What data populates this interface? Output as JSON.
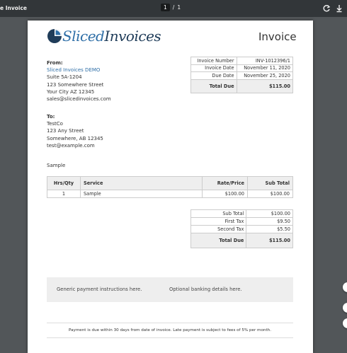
{
  "viewer": {
    "title": "e Invoice",
    "current_page": "1",
    "page_sep": "/",
    "total_pages": "1"
  },
  "logo": {
    "part1": "Sliced",
    "part2": "Invoices"
  },
  "heading": "Invoice",
  "from": {
    "label": "From:",
    "name": "Sliced Invoices DEMO",
    "address1": "Suite 5A-1204",
    "address2": "123 Somewhere Street",
    "address3": "Your City AZ 12345",
    "email": "sales@slicedinvoices.com"
  },
  "meta": [
    {
      "label": "Invoice Number",
      "value": "INV-1012396/1"
    },
    {
      "label": "Invoice Date",
      "value": "November 11, 2020"
    },
    {
      "label": "Due Date",
      "value": "November 25, 2020"
    }
  ],
  "meta_total": {
    "label": "Total Due",
    "value": "$115.00"
  },
  "to": {
    "label": "To:",
    "name": "TestCo",
    "address1": "123 Any Street",
    "address2": "Somewhere, AB 12345",
    "email": "test@example.com"
  },
  "description": "Sample",
  "items": {
    "headers": [
      "Hrs/Qty",
      "Service",
      "Rate/Price",
      "Sub Total"
    ],
    "rows": [
      {
        "qty": "1",
        "service": "Sample",
        "rate": "$100.00",
        "subtotal": "$100.00"
      }
    ]
  },
  "totals": [
    {
      "label": "Sub Total",
      "value": "$100.00"
    },
    {
      "label": "First Tax",
      "value": "$9.50"
    },
    {
      "label": "Second Tax",
      "value": "$5.50"
    }
  ],
  "totals_total": {
    "label": "Total Due",
    "value": "$115.00"
  },
  "payment": {
    "left": "Generic payment instructions here.",
    "right": "Optional banking details here."
  },
  "footer": "Payment is due within 30 days from date of invoice. Late payment is subject to fees of 5% per month."
}
